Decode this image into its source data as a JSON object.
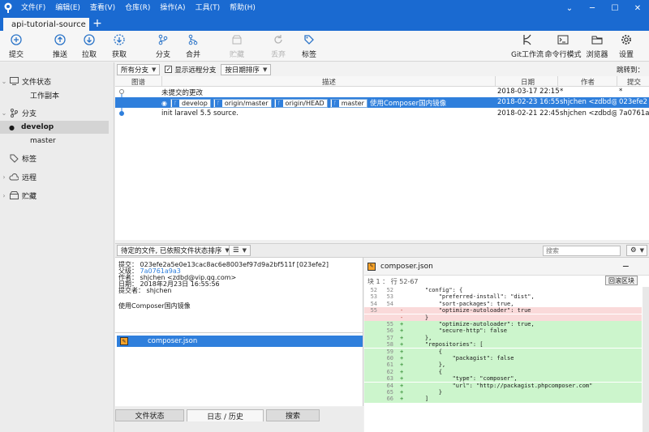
{
  "menu": [
    "文件(F)",
    "编辑(E)",
    "查看(V)",
    "仓库(R)",
    "操作(A)",
    "工具(T)",
    "帮助(H)"
  ],
  "window_controls": {
    "menu": "⌄",
    "minimize": "─",
    "maximize": "☐",
    "close": "✕"
  },
  "tab": {
    "title": "api-tutorial-source",
    "add": "+"
  },
  "toolbar": {
    "commit": "提交",
    "push": "推送",
    "pull": "拉取",
    "fetch": "获取",
    "branch": "分支",
    "merge": "合并",
    "stash": "贮藏",
    "discard": "丢弃",
    "tag": "标签",
    "gitflow": "Git工作流",
    "terminal": "命令行模式",
    "explorer": "浏览器",
    "settings": "设置"
  },
  "sidebar": {
    "file_status": "文件状态",
    "working_copy": "工作副本",
    "branches": "分支",
    "branch_items": [
      "develop",
      "master"
    ],
    "tags": "标签",
    "remotes": "远程",
    "stashes": "贮藏"
  },
  "filters": {
    "branch_select": "所有分支",
    "show_remote": "显示远程分支",
    "show_remote_checked": true,
    "sort_select": "按日期排序",
    "jump_to": "跳转到："
  },
  "columns": {
    "graph": "图谱",
    "description": "描述",
    "date": "日期",
    "author": "作者",
    "commit": "提交"
  },
  "commits": [
    {
      "description": "未提交的更改",
      "tags": [],
      "date": "2018-03-17 22:15",
      "author": "*",
      "hash": "*"
    },
    {
      "description": "使用Composer国内镜像",
      "tags": [
        "develop",
        "origin/master",
        "origin/HEAD",
        "master"
      ],
      "date": "2018-02-23 16:55",
      "author": "shjchen <zdbd@",
      "hash": "023efe2"
    },
    {
      "description": "init laravel 5.5 source.",
      "tags": [],
      "date": "2018-02-21 22:45",
      "author": "shjchen <zdbd@",
      "hash": "7a0761a"
    }
  ],
  "lower_bar": {
    "file_sort": "待定的文件, 已依照文件状态排序",
    "view_mode": "☰",
    "search_placeholder": "搜索"
  },
  "detail": {
    "commit_line": "提交： 023efe2a5e0e13cac8ac6e8003ef97d9a2bf511f [023efe2]",
    "parent_label": "父级：",
    "parent_value": "7a0761a9a3",
    "author_line": "作者： shjchen <zdbd@vip.qq.com>",
    "date_line": "日期： 2018年2月23日 16:55:56",
    "committer_line": "提交者： shjchen",
    "message": "使用Composer国内镜像"
  },
  "files": [
    {
      "name": "composer.json"
    }
  ],
  "diff": {
    "file": "composer.json",
    "hunk": "块 1 ： 行 52-67",
    "hunk_button": "回滚区块",
    "lines": [
      {
        "o": "52",
        "n": "52",
        "s": "",
        "t": "    \"config\": {",
        "k": "ctx"
      },
      {
        "o": "53",
        "n": "53",
        "s": "",
        "t": "        \"preferred-install\": \"dist\",",
        "k": "ctx"
      },
      {
        "o": "54",
        "n": "54",
        "s": "",
        "t": "        \"sort-packages\": true,",
        "k": "ctx"
      },
      {
        "o": "55",
        "n": "",
        "s": "-",
        "t": "        \"optimize-autoloader\": true",
        "k": "del"
      },
      {
        "o": "",
        "n": "",
        "s": "-",
        "t": "    }",
        "k": "del"
      },
      {
        "o": "",
        "n": "55",
        "s": "+",
        "t": "        \"optimize-autoloader\": true,",
        "k": "add"
      },
      {
        "o": "",
        "n": "56",
        "s": "+",
        "t": "        \"secure-http\": false",
        "k": "add"
      },
      {
        "o": "",
        "n": "57",
        "s": "+",
        "t": "    },",
        "k": "add"
      },
      {
        "o": "",
        "n": "58",
        "s": "+",
        "t": "    \"repositories\": [",
        "k": "add"
      },
      {
        "o": "",
        "n": "59",
        "s": "+",
        "t": "        {",
        "k": "add"
      },
      {
        "o": "",
        "n": "60",
        "s": "+",
        "t": "            \"packagist\": false",
        "k": "add"
      },
      {
        "o": "",
        "n": "61",
        "s": "+",
        "t": "        },",
        "k": "add"
      },
      {
        "o": "",
        "n": "62",
        "s": "+",
        "t": "        {",
        "k": "add"
      },
      {
        "o": "",
        "n": "63",
        "s": "+",
        "t": "            \"type\": \"composer\",",
        "k": "add"
      },
      {
        "o": "",
        "n": "64",
        "s": "+",
        "t": "            \"url\": \"http://packagist.phpcomposer.com\"",
        "k": "add"
      },
      {
        "o": "",
        "n": "65",
        "s": "+",
        "t": "        }",
        "k": "add"
      },
      {
        "o": "",
        "n": "66",
        "s": "+",
        "t": "    ]",
        "k": "add"
      }
    ]
  },
  "bottom_tabs": [
    "文件状态",
    "日志 / 历史",
    "搜索"
  ],
  "colors": {
    "accent": "#1a6ad1",
    "selection": "#2f7fdc",
    "added": "#ccf5cc",
    "removed": "#fadada"
  }
}
